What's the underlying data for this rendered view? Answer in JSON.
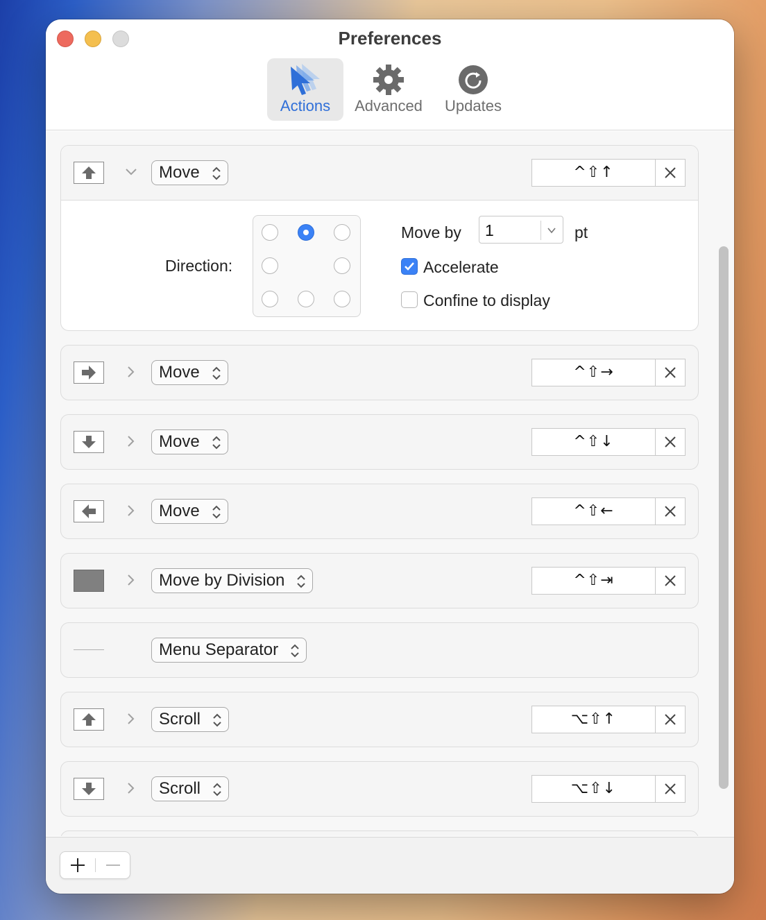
{
  "window": {
    "title": "Preferences"
  },
  "toolbar": {
    "actions_label": "Actions",
    "advanced_label": "Advanced",
    "updates_label": "Updates",
    "selected": "Actions"
  },
  "expanded_action": {
    "direction_label": "Direction:",
    "direction_selected": "up",
    "move_by_label": "Move by",
    "move_by_value": "1",
    "unit_label": "pt",
    "accelerate_label": "Accelerate",
    "accelerate_checked": true,
    "confine_label": "Confine to display",
    "confine_checked": false
  },
  "actions": [
    {
      "icon": "arrow-up-icon",
      "action": "Move",
      "shortcut": "^⇧↑",
      "expanded": true
    },
    {
      "icon": "arrow-right-icon",
      "action": "Move",
      "shortcut": "^⇧→",
      "expanded": false
    },
    {
      "icon": "arrow-down-icon",
      "action": "Move",
      "shortcut": "^⇧↓",
      "expanded": false
    },
    {
      "icon": "arrow-left-icon",
      "action": "Move",
      "shortcut": "^⇧←",
      "expanded": false
    },
    {
      "icon": "rectangle-icon",
      "action": "Move by Division",
      "shortcut": "^⇧⇥",
      "expanded": false
    },
    {
      "icon": "separator-line-icon",
      "action": "Menu Separator",
      "shortcut": "",
      "expanded": false
    },
    {
      "icon": "arrow-up-icon",
      "action": "Scroll",
      "shortcut": "⌥⇧↑",
      "expanded": false
    },
    {
      "icon": "arrow-down-icon",
      "action": "Scroll",
      "shortcut": "⌥⇧↓",
      "expanded": false
    }
  ],
  "footer": {
    "add_label": "+",
    "remove_label": "−"
  },
  "colors": {
    "accent": "#2f6fd8",
    "selected_tab_bg": "#e8e8e8"
  }
}
